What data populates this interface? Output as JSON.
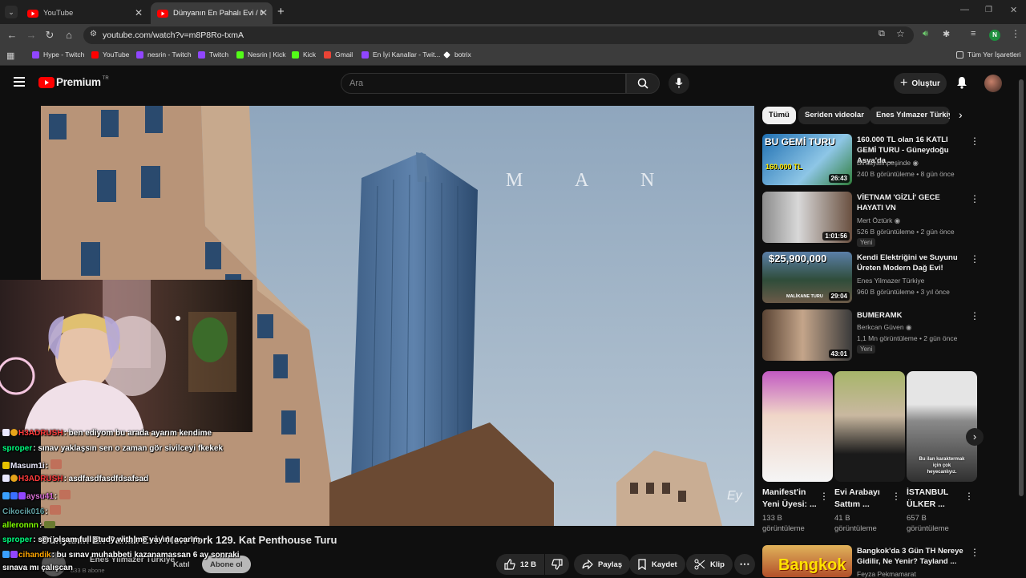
{
  "browser": {
    "tabs": [
      {
        "title": "YouTube",
        "active": false
      },
      {
        "title": "Dünyanın En Pahalı Evi / New Y",
        "active": true
      }
    ],
    "url": "youtube.com/watch?v=m8P8Ro-txmA",
    "profile_initial": "N",
    "bookmarks": [
      {
        "label": "Hype - Twitch",
        "color": "#9146ff"
      },
      {
        "label": "YouTube",
        "color": "#ff0000"
      },
      {
        "label": "nesrin - Twitch",
        "color": "#9146ff"
      },
      {
        "label": "Twitch",
        "color": "#9146ff"
      },
      {
        "label": "Nesrin | Kick",
        "color": "#53fc18"
      },
      {
        "label": "Kick",
        "color": "#53fc18"
      },
      {
        "label": "Gmail",
        "color": "#ea4335"
      },
      {
        "label": "En İyi Kanallar - Twit...",
        "color": "#9146ff"
      },
      {
        "label": "botrix",
        "color": "#ffffff"
      }
    ],
    "all_bookmarks": "Tüm Yer İşaretleri"
  },
  "youtube": {
    "logo_text": "Premium",
    "logo_region": "TR",
    "search_placeholder": "Ara",
    "create_label": "Oluştur",
    "video_overlay_text": "M A N",
    "watermark": "Ey",
    "video_title": "Dünyanın En Pahalı Evi / New York 129. Kat Penthouse Turu",
    "channel_name": "Enes Yılmazer Türkiye",
    "subscribers": "833 B abone",
    "join_label": "Katıl",
    "subscribe_label": "Abone ol",
    "actions": {
      "likes": "12 B",
      "share": "Paylaş",
      "save": "Kaydet",
      "clip": "Klip"
    },
    "chips": [
      "Tümü",
      "Seriden videolar",
      "Enes Yılmazer Türkiye"
    ],
    "related": [
      {
        "title": "160.000 TL olan 16 KATLI GEMİ TURU - Güneydoğu Asya'da ...",
        "channel": "Birhayalinpeşinde",
        "meta": "240 B görüntüleme • 8 gün önce",
        "duration": "26:43",
        "thumb_text": "BU GEMİ TURU",
        "thumb_sub": "160.000 TL",
        "new": ""
      },
      {
        "title": "VİETNAM 'GİZLİ' GECE HAYATI VN",
        "channel": "Mert Öztürk",
        "meta": "526 B görüntüleme • 2 gün önce",
        "duration": "1:01:56",
        "thumb_text": "",
        "thumb_sub": "",
        "new": "Yeni"
      },
      {
        "title": "Kendi Elektriğini ve Suyunu Üreten Modern Dağ Evi!",
        "channel": "Enes Yilmazer Türkiye",
        "meta": "960 B görüntüleme • 3 yıl önce",
        "duration": "29:04",
        "thumb_text": "$25,900,000",
        "thumb_sub": "MALİKANE TURU",
        "new": ""
      },
      {
        "title": "BUMERAMK",
        "channel": "Berkcan Güven",
        "meta": "1,1 Mn görüntüleme • 2 gün önce",
        "duration": "43:01",
        "thumb_text": "",
        "thumb_sub": "",
        "new": "Yeni"
      }
    ],
    "shorts": [
      {
        "title": "Manifest'in Yeni Üyesi: ...",
        "views": "133 B görüntüleme"
      },
      {
        "title": "Evi Arabayı Sattım ...",
        "views": "41 B görüntüleme"
      },
      {
        "title": "İSTANBUL ÜLKER ...",
        "views": "657 B görüntüleme",
        "overlay": "Bu ilan karaktermak için çok heyecanlıyız."
      }
    ],
    "bottom_related": {
      "title": "Bangkok'da 3 Gün TH Nereye Gidilir, Ne Yenir? Tayland ...",
      "channel": "Feyza Pekmamarat",
      "thumb_text": "Bangkok"
    }
  },
  "chat": [
    {
      "user": "H3ADRUSH",
      "color": "#ff3b3b",
      "msg": ": ben ediyom bu arada ayarım kendime"
    },
    {
      "user": "sproper",
      "color": "#00ff7f",
      "msg": ": sınav yaklaşsın sen o zaman gör sivilceyi fkekek"
    },
    {
      "user": "Masum1i",
      "color": "#e6e6fa",
      "msg": ":"
    },
    {
      "user": "H3ADRUSH",
      "color": "#ff3b3b",
      "msg": ": asdfasdfasdfdsafsad"
    },
    {
      "user": "aysu41",
      "color": "#da70d6",
      "msg": ":"
    },
    {
      "user": "Cikocik016",
      "color": "#5f9ea0",
      "msg": ":"
    },
    {
      "user": "alleronnn",
      "color": "#7fff00",
      "msg": ":"
    },
    {
      "user": "sproper",
      "color": "#00ff7f",
      "msg": ": sen olsam full study with me yayını açarım"
    },
    {
      "user": "cihandik",
      "color": "#ffa500",
      "msg": ": bu sınav muhabbeti kazanamassan 6 ay sonraki"
    },
    {
      "user": "",
      "color": "#ffffff",
      "msg": "sınava mı çalışcan"
    }
  ]
}
